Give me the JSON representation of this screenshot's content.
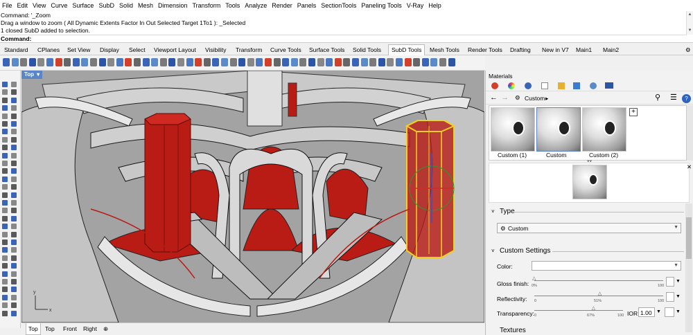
{
  "menu": [
    "File",
    "Edit",
    "View",
    "Curve",
    "Surface",
    "SubD",
    "Solid",
    "Mesh",
    "Dimension",
    "Transform",
    "Tools",
    "Analyze",
    "Render",
    "Panels",
    "SectionTools",
    "Paneling Tools",
    "V-Ray",
    "Help"
  ],
  "command": {
    "line1": "Command: '_Zoom",
    "line2": "Drag a window to zoom ( All  Dynamic  Extents  Factor  In  Out  Selected  Target  1To1 ): _Selected",
    "line3": "1 closed SubD added to selection.",
    "prompt": "Command:"
  },
  "tabs": [
    "Standard",
    "CPlanes",
    "Set View",
    "Display",
    "Select",
    "Viewport Layout",
    "Visibility",
    "Transform",
    "Curve Tools",
    "Surface Tools",
    "Solid Tools",
    "SubD Tools",
    "Mesh Tools",
    "Render Tools",
    "Drafting",
    "New in V7",
    "Main1",
    "Main2"
  ],
  "active_tab": "SubD Tools",
  "viewport": {
    "label": "Top"
  },
  "view_tabs": [
    "Top",
    "Top",
    "Front",
    "Right"
  ],
  "active_view_tab": "Top",
  "panel": {
    "title": "Materials",
    "breadcrumb": "Custom",
    "swatches": [
      "Custom (1)",
      "Custom",
      "Custom (2)"
    ],
    "sections": {
      "type": "Type",
      "custom_settings": "Custom Settings",
      "textures": "Textures"
    },
    "type_value": "Custom",
    "labels": {
      "color": "Color:",
      "gloss": "Gloss finish:",
      "reflectivity": "Reflectivity:",
      "transparency": "Transparency:",
      "ior": "IOR:"
    },
    "gloss": {
      "min": "0%",
      "max": "100",
      "value": 0.0
    },
    "reflectivity": {
      "min": "0",
      "max": "100",
      "mid_label": "51%",
      "value": 0.51
    },
    "transparency": {
      "min": "0",
      "max": "100",
      "mid_label": "67%",
      "value": 0.67
    },
    "ior_value": "1.00"
  },
  "colors": {
    "accent": "#5a86c7",
    "model_red": "#b81c14",
    "selection": "#f2d022",
    "grey_surface": "#c8c8c8"
  }
}
